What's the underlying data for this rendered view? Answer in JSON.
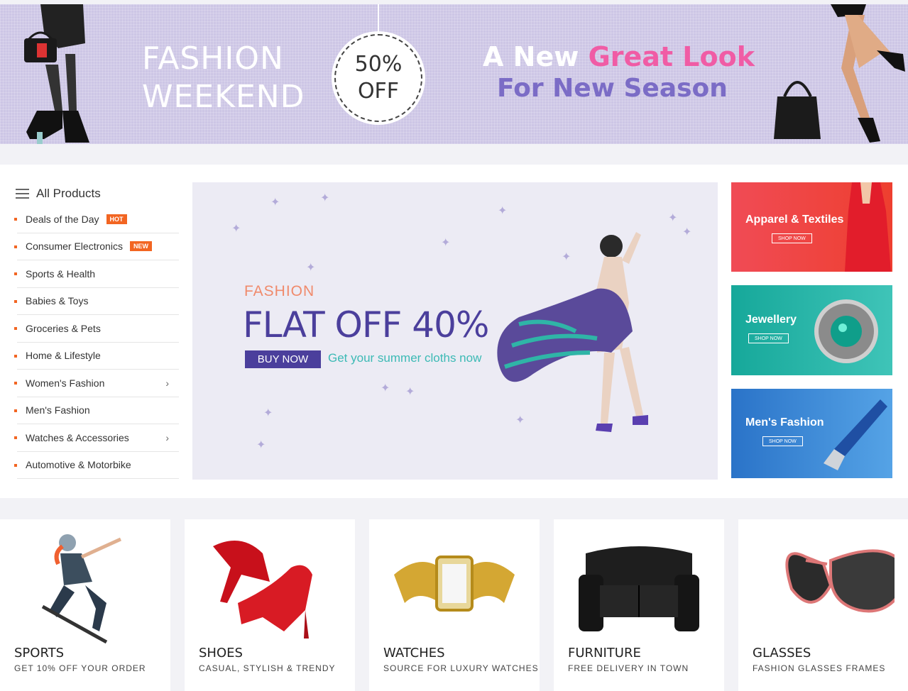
{
  "top_banner": {
    "title_line1": "FASHION",
    "title_line2": "WEEKEND",
    "badge_line1": "50%",
    "badge_line2": "OFF",
    "slogan_part1": "A New ",
    "slogan_part2": "Great Look",
    "slogan_line2": "For New Season"
  },
  "sidebar": {
    "title": "All Products",
    "items": [
      {
        "label": "Deals of the Day",
        "tag": "HOT"
      },
      {
        "label": "Consumer Electronics",
        "tag": "NEW"
      },
      {
        "label": "Sports & Health"
      },
      {
        "label": "Babies & Toys"
      },
      {
        "label": "Groceries & Pets"
      },
      {
        "label": "Home & Lifestyle"
      },
      {
        "label": "Women's Fashion",
        "arrow": "›"
      },
      {
        "label": "Men's Fashion"
      },
      {
        "label": "Watches & Accessories",
        "arrow": "›"
      },
      {
        "label": "Automotive & Motorbike"
      }
    ]
  },
  "hero": {
    "kicker": "FASHION",
    "headline": "FLAT OFF 40%",
    "button": "BUY NOW",
    "subtitle": "Get your summer cloths now"
  },
  "promos": [
    {
      "title": "Apparel & Textiles",
      "button": "SHOP NOW"
    },
    {
      "title": "Jewellery",
      "button": "SHOP NOW"
    },
    {
      "title": "Men's Fashion",
      "button": "SHOP NOW"
    }
  ],
  "categories": [
    {
      "title": "SPORTS",
      "subtitle": "GET 10% OFF YOUR ORDER"
    },
    {
      "title": "SHOES",
      "subtitle": "CASUAL, STYLISH & TRENDY"
    },
    {
      "title": "WATCHES",
      "subtitle": "SOURCE FOR LUXURY WATCHES"
    },
    {
      "title": "FURNITURE",
      "subtitle": "FREE DELIVERY IN TOWN"
    },
    {
      "title": "GLASSES",
      "subtitle": "FASHION GLASSES FRAMES"
    }
  ],
  "colors": {
    "accent_orange": "#f26522",
    "hero_purple": "#4b3f9c",
    "hero_teal": "#3cbab5",
    "banner_lilac": "#cdc6e5"
  }
}
